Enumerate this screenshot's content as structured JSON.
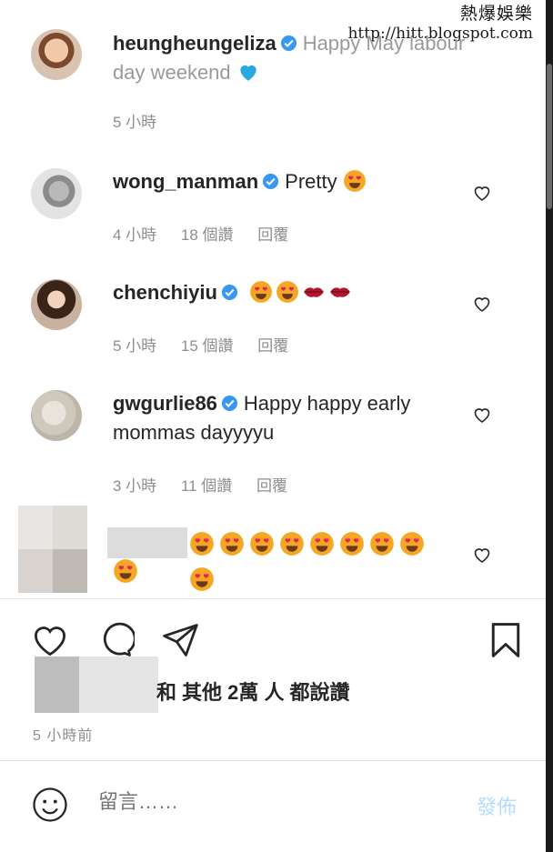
{
  "watermark": {
    "title": "熱爆娛樂",
    "url": "http://hitt.blogspot.com"
  },
  "comments": [
    {
      "username": "heungheungeliza",
      "text": "Happy May labour day weekend",
      "trailing_emoji": "blue-heart",
      "time": "5 小時",
      "likes": "",
      "reply": ""
    },
    {
      "username": "wong_manman",
      "text": "Pretty",
      "trailing_emoji": "heart-eyes",
      "time": "4 小時",
      "likes": "18 個讚",
      "reply": "回覆"
    },
    {
      "username": "chenchiyiu",
      "text": "",
      "emojis": [
        "heart-eyes",
        "heart-eyes",
        "kiss-lips",
        "kiss-lips"
      ],
      "time": "5 小時",
      "likes": "15 個讚",
      "reply": "回覆"
    },
    {
      "username": "gwgurlie86",
      "text": "Happy happy early mommas dayyyyu",
      "time": "3 小時",
      "likes": "11 個讚",
      "reply": "回覆"
    },
    {
      "username": "",
      "emoji_count": 10,
      "emoji": "heart-eyes"
    }
  ],
  "actions": {
    "like_icon": "heart-outline-icon",
    "comment_icon": "comment-bubble-icon",
    "share_icon": "paper-plane-icon",
    "save_icon": "bookmark-icon"
  },
  "likes_summary": {
    "and": "和",
    "others": "其他 2萬 人",
    "suffix": "都說讚"
  },
  "post_time": "5 小時前",
  "comment_box": {
    "emoji_icon": "smiley-icon",
    "placeholder": "留言……",
    "post_label": "發佈"
  },
  "colors": {
    "verified": "#3897f0",
    "muted_text": "#8e8e8e",
    "post_button_disabled": "#b3dbff",
    "heart_eyes_face": "#f5a623",
    "heart": "#e0245e",
    "blue_heart": "#2aa8e0"
  }
}
